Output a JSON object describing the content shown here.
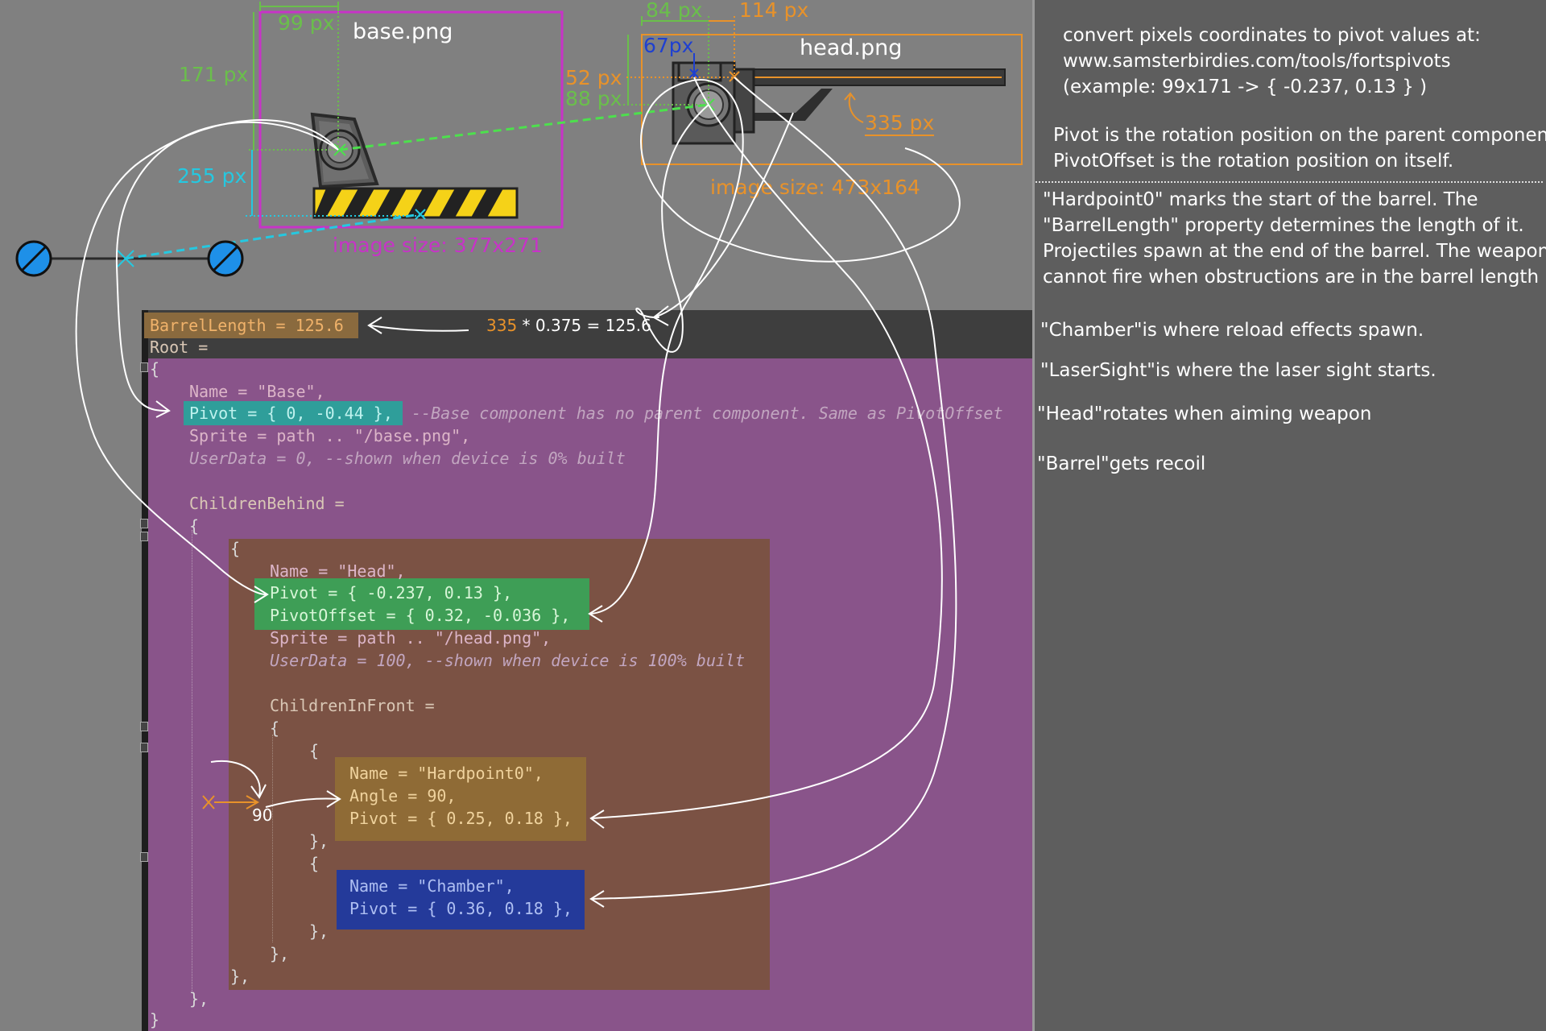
{
  "colors": {
    "green": "#6abf4b",
    "cyan": "#25c8e0",
    "magenta": "#c733c7",
    "orange": "#e8922a",
    "blue": "#1f40d0",
    "purple_bg": "#89548a",
    "head_box": "#7b5244",
    "hardpoint_box": "#8f6b36",
    "chamber_box": "#243a9a",
    "pivot_box": "#3e9e56",
    "base_pivot_box": "#2f9e9a",
    "barrel_box": "#8a6a3e"
  },
  "icons": [
    "weapon-base-image",
    "weapon-head-image",
    "joint-circle-icon",
    "cross-marker-icon"
  ],
  "base": {
    "filename": "base.png",
    "width_px": "99 px",
    "height_px": "171 px",
    "lower_px": "255 px",
    "size": "image size: 377x271"
  },
  "head": {
    "filename": "head.png",
    "px84": "84 px",
    "px114": "114 px",
    "px67": "67px",
    "px52": "52 px",
    "px88": "88 px",
    "px335": "335 px",
    "size": "image size: 473x164"
  },
  "calc": {
    "num": "335",
    "rest": " * 0.375 = 125.6"
  },
  "angle_label": "90",
  "code": {
    "barrel_length": "BarrelLength = 125.6",
    "root": "Root =",
    "open_brace": "{",
    "base_name": "Name = \"Base\",",
    "base_pivot": "Pivot = { 0, -0.44 },",
    "base_pivot_comment": "--Base component has no parent component. Same as PivotOffset",
    "base_sprite": "Sprite = path .. \"/base.png\",",
    "base_userdata": "UserData = 0, --shown when device is 0% built",
    "children_behind": "ChildrenBehind =",
    "cb_open": "{",
    "head_open": "{",
    "head_name": "Name = \"Head\",",
    "head_pivot": "Pivot = { -0.237, 0.13 },",
    "head_pivot_offset": "PivotOffset = { 0.32, -0.036 },",
    "head_sprite": "Sprite = path .. \"/head.png\",",
    "head_userdata": "UserData = 100, --shown when device is 100% built",
    "children_in_front": "ChildrenInFront =",
    "cif_open": "{",
    "hp_open": "{",
    "hp_name": "Name = \"Hardpoint0\",",
    "hp_angle": "Angle = 90,",
    "hp_pivot": "Pivot = { 0.25, 0.18 },",
    "hp_close": "},",
    "ch_open": "{",
    "ch_name": "Name = \"Chamber\",",
    "ch_pivot": "Pivot = { 0.36, 0.18 },",
    "ch_close": "},",
    "cif_close": "},",
    "head_close": "},",
    "cb_close": "},",
    "root_close": "}"
  },
  "notes": {
    "convert_line1": "convert pixels coordinates to pivot values at:",
    "convert_line2": "www.samsterbirdies.com/tools/fortspivots",
    "convert_line3": "(example: 99x171 -> { -0.237, 0.13 } )",
    "pivot_line1": "Pivot is the rotation position on the parent component.",
    "pivot_line2": "PivotOffset is the rotation position on itself.",
    "hardpoint_line1": "\"Hardpoint0\" marks the start of the barrel. The",
    "hardpoint_line2": "\"BarrelLength\" property determines the length of it.",
    "hardpoint_line3": "Projectiles spawn at the end of the barrel. The weapon",
    "hardpoint_line4": "cannot fire when obstructions are in the barrel length",
    "chamber": "\"Chamber\"is where reload effects spawn.",
    "lasersight": "\"LaserSight\"is where the laser sight starts.",
    "head_rotates": "\"Head\"rotates when aiming weapon",
    "barrel_recoil": "\"Barrel\"gets recoil"
  }
}
